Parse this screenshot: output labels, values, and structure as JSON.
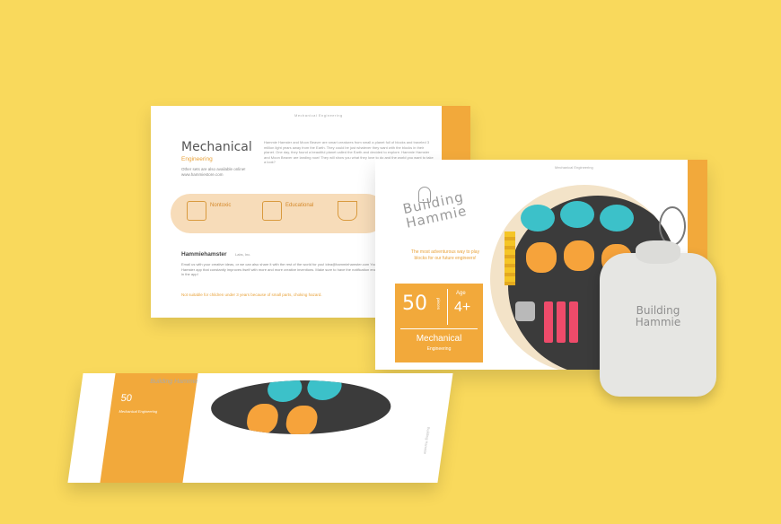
{
  "back_box": {
    "top_text": "Mechanical Engineering",
    "title": "Mechanical",
    "subtitle": "Engineering",
    "note": "Other sets are also available online! www.hammiestore.com",
    "body": "Hammie Hamster and Moon Beaver are smart creatures from small a planet full of blocks and traveled 3 million light years away from the Earth. They could be just whatever they want with the blocks in their planet. One day, they found a beautiful planet called the Earth and decided to explore. Hammie Hamster and Moon Beaver are landing now! They will show you what they love to do and the world you want to take a look?",
    "features": [
      "Nontoxic",
      "Educational"
    ],
    "owner": "Hammiehamster",
    "owner_tag": "Labs, Inc.",
    "text": "Email us with your creative ideas, or we can also share it with the rest of the world for you! idea@hammiehamster.com You can download the Hammie Hamster app that constantly improves itself with more and more creative inventions. Make sure to have the notification enabled to get the latest updates in the app!",
    "warning": "Not suitable for children under 3 years because of small parts, choking hazard."
  },
  "front_box": {
    "top_text": "Mechanical Engineering",
    "logo_line1": "Building",
    "logo_line2": "Hammie",
    "tagline": "The most adventurous way to play blocks for our future engineers!",
    "pieces": "50",
    "pieces_label": "pieces",
    "age_label": "Age",
    "age": "4+",
    "title": "Mechanical",
    "subtitle": "Engineering"
  },
  "bag": {
    "logo_line1": "Building",
    "logo_line2": "Hammie"
  },
  "lying_box": {
    "logo": "Building Hammie",
    "band_num": "50",
    "band_text": "Mechanical Engineering",
    "side_text": "Building Hammie"
  },
  "colors": {
    "background": "#f9d95c",
    "accent": "#f2a93b",
    "teal": "#3cc1c9",
    "pink": "#ee4b6a"
  }
}
